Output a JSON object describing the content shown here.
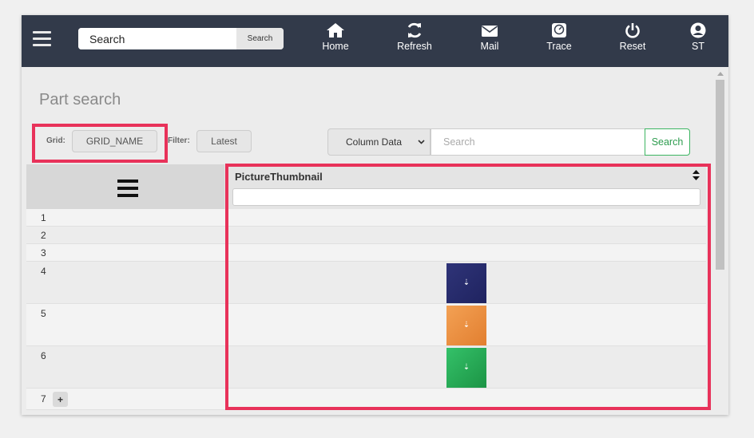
{
  "navbar": {
    "search_value": "Search",
    "search_button": "Search",
    "items": [
      {
        "label": "Home",
        "icon": "home-icon"
      },
      {
        "label": "Refresh",
        "icon": "refresh-icon"
      },
      {
        "label": "Mail",
        "icon": "mail-icon"
      },
      {
        "label": "Trace",
        "icon": "trace-icon"
      },
      {
        "label": "Reset",
        "icon": "power-icon"
      },
      {
        "label": "ST",
        "icon": "user-icon"
      }
    ],
    "background": "#323a4a"
  },
  "page": {
    "title": "Part search"
  },
  "toolbar": {
    "grid_label": "Grid:",
    "grid_value": "GRID_NAME",
    "filter_label": "Filter:",
    "filter_value": "Latest",
    "column_select": "Column Data",
    "search_placeholder": "Search",
    "search_button": "Search"
  },
  "table": {
    "column_header": "PictureThumbnail",
    "rows": [
      {
        "num": "1",
        "thumbnail": null
      },
      {
        "num": "2",
        "thumbnail": null
      },
      {
        "num": "3",
        "thumbnail": null
      },
      {
        "num": "4",
        "thumbnail": "#262b6b"
      },
      {
        "num": "5",
        "thumbnail": "#ee8f3f"
      },
      {
        "num": "6",
        "thumbnail": "#23a853"
      },
      {
        "num": "7",
        "thumbnail": null
      }
    ],
    "add_row_label": "+"
  },
  "colors": {
    "highlight": "#e8325a",
    "search_green": "#3cb561"
  }
}
